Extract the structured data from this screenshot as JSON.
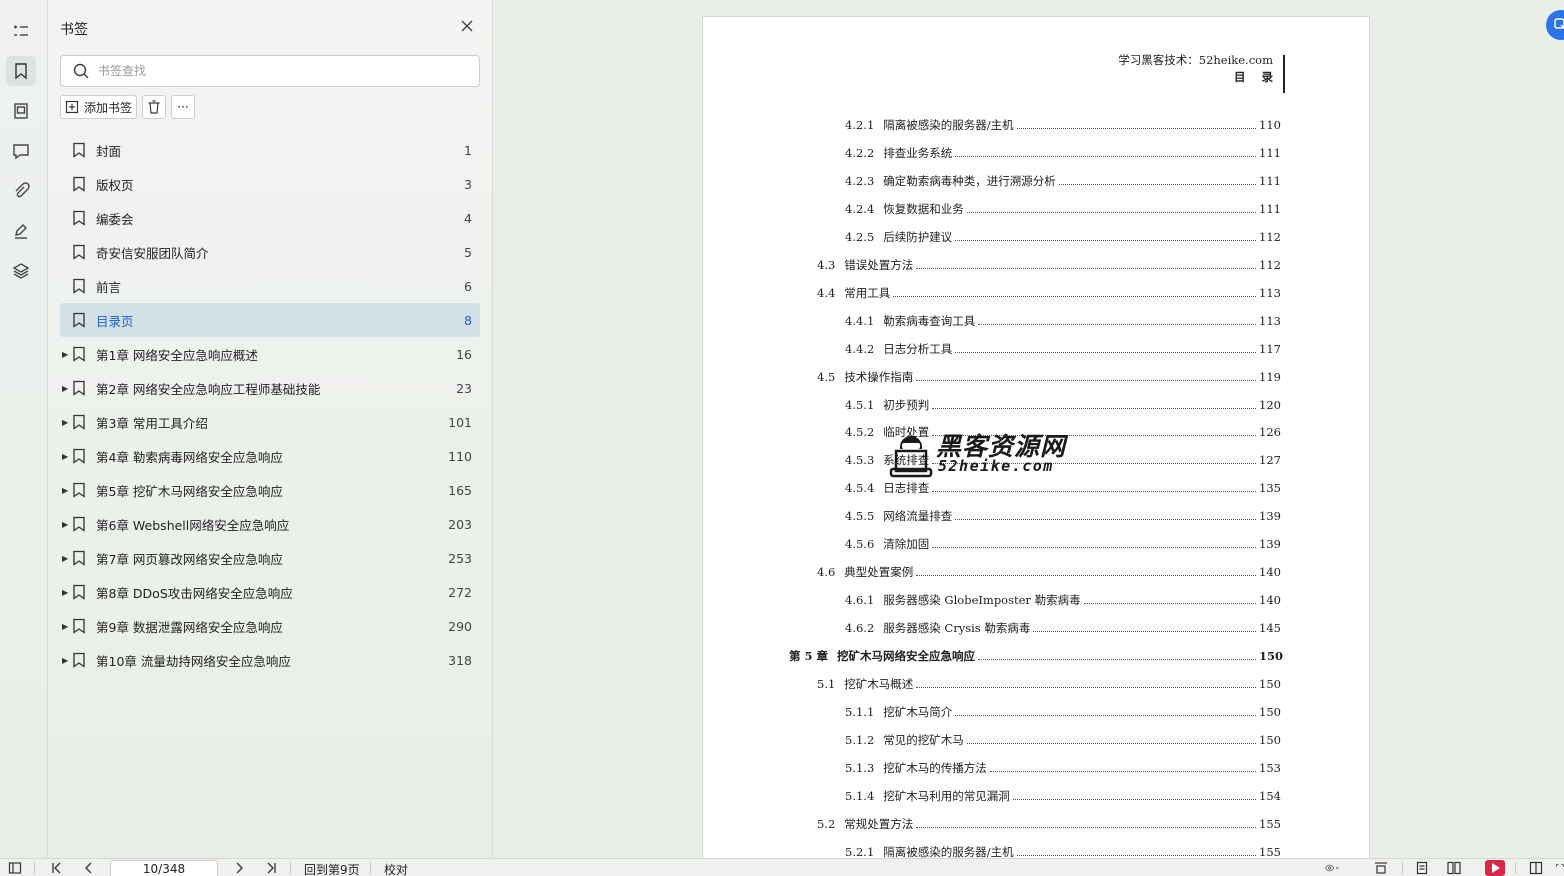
{
  "panel": {
    "title": "书签",
    "search_placeholder": "书签查找",
    "add_label": "添加书签",
    "more_label": "···"
  },
  "bookmarks": [
    {
      "label": "封面",
      "page": "1",
      "expandable": false
    },
    {
      "label": "版权页",
      "page": "3",
      "expandable": false
    },
    {
      "label": "编委会",
      "page": "4",
      "expandable": false
    },
    {
      "label": "奇安信安服团队简介",
      "page": "5",
      "expandable": false
    },
    {
      "label": "前言",
      "page": "6",
      "expandable": false
    },
    {
      "label": "目录页",
      "page": "8",
      "expandable": false,
      "selected": true
    },
    {
      "label": "第1章  网络安全应急响应概述",
      "page": "16",
      "expandable": true
    },
    {
      "label": "第2章  网络安全应急响应工程师基础技能",
      "page": "23",
      "expandable": true
    },
    {
      "label": "第3章  常用工具介绍",
      "page": "101",
      "expandable": true
    },
    {
      "label": "第4章  勒索病毒网络安全应急响应",
      "page": "110",
      "expandable": true
    },
    {
      "label": "第5章  挖矿木马网络安全应急响应",
      "page": "165",
      "expandable": true
    },
    {
      "label": "第6章  Webshell网络安全应急响应",
      "page": "203",
      "expandable": true
    },
    {
      "label": "第7章  网页篡改网络安全应急响应",
      "page": "253",
      "expandable": true
    },
    {
      "label": "第8章  DDoS攻击网络安全应急响应",
      "page": "272",
      "expandable": true
    },
    {
      "label": "第9章  数据泄露网络安全应急响应",
      "page": "290",
      "expandable": true
    },
    {
      "label": "第10章  流量劫持网络安全应急响应",
      "page": "318",
      "expandable": true
    }
  ],
  "document": {
    "header_line1": "学习黑客技术：52heike.com",
    "header_line2": "目    录",
    "toc": [
      {
        "num": "4.2.1",
        "title": "隔离被感染的服务器/主机",
        "page": "110",
        "level": 2
      },
      {
        "num": "4.2.2",
        "title": "排查业务系统",
        "page": "111",
        "level": 2
      },
      {
        "num": "4.2.3",
        "title": "确定勒索病毒种类，进行溯源分析",
        "page": "111",
        "level": 2
      },
      {
        "num": "4.2.4",
        "title": "恢复数据和业务",
        "page": "111",
        "level": 2
      },
      {
        "num": "4.2.5",
        "title": "后续防护建议",
        "page": "112",
        "level": 2
      },
      {
        "num": "4.3",
        "title": "错误处置方法",
        "page": "112",
        "level": 1
      },
      {
        "num": "4.4",
        "title": "常用工具",
        "page": "113",
        "level": 1
      },
      {
        "num": "4.4.1",
        "title": "勒索病毒查询工具",
        "page": "113",
        "level": 2
      },
      {
        "num": "4.4.2",
        "title": "日志分析工具",
        "page": "117",
        "level": 2
      },
      {
        "num": "4.5",
        "title": "技术操作指南",
        "page": "119",
        "level": 1
      },
      {
        "num": "4.5.1",
        "title": "初步预判",
        "page": "120",
        "level": 2
      },
      {
        "num": "4.5.2",
        "title": "临时处置",
        "page": "126",
        "level": 2
      },
      {
        "num": "4.5.3",
        "title": "系统排查",
        "page": "127",
        "level": 2
      },
      {
        "num": "4.5.4",
        "title": "日志排查",
        "page": "135",
        "level": 2
      },
      {
        "num": "4.5.5",
        "title": "网络流量排查",
        "page": "139",
        "level": 2
      },
      {
        "num": "4.5.6",
        "title": "清除加固",
        "page": "139",
        "level": 2
      },
      {
        "num": "4.6",
        "title": "典型处置案例",
        "page": "140",
        "level": 1
      },
      {
        "num": "4.6.1",
        "title": "服务器感染 GlobeImposter 勒索病毒",
        "page": "140",
        "level": 2
      },
      {
        "num": "4.6.2",
        "title": "服务器感染 Crysis 勒索病毒",
        "page": "145",
        "level": 2
      },
      {
        "num": "第 5 章",
        "title": "挖矿木马网络安全应急响应",
        "page": "150",
        "level": 0
      },
      {
        "num": "5.1",
        "title": "挖矿木马概述",
        "page": "150",
        "level": 1
      },
      {
        "num": "5.1.1",
        "title": "挖矿木马简介",
        "page": "150",
        "level": 2
      },
      {
        "num": "5.1.2",
        "title": "常见的挖矿木马",
        "page": "150",
        "level": 2
      },
      {
        "num": "5.1.3",
        "title": "挖矿木马的传播方法",
        "page": "153",
        "level": 2
      },
      {
        "num": "5.1.4",
        "title": "挖矿木马利用的常见漏洞",
        "page": "154",
        "level": 2
      },
      {
        "num": "5.2",
        "title": "常规处置方法",
        "page": "155",
        "level": 1
      },
      {
        "num": "5.2.1",
        "title": "隔离被感染的服务器/主机",
        "page": "155",
        "level": 2
      }
    ],
    "watermark_cn": "黑客资源网",
    "watermark_en": "52heike.com"
  },
  "statusbar": {
    "page_indicator": "10/348",
    "back_to_page": "回到第9页",
    "proofread": "校对"
  },
  "icons": {
    "rail": [
      "toc-icon",
      "bookmark-icon",
      "thumbnail-icon",
      "comment-icon",
      "attachment-icon",
      "signature-icon",
      "layers-icon"
    ]
  },
  "colors": {
    "accent": "#1a5fd0",
    "selected_row": "#d4e0e8",
    "record_red": "#d8284a"
  }
}
